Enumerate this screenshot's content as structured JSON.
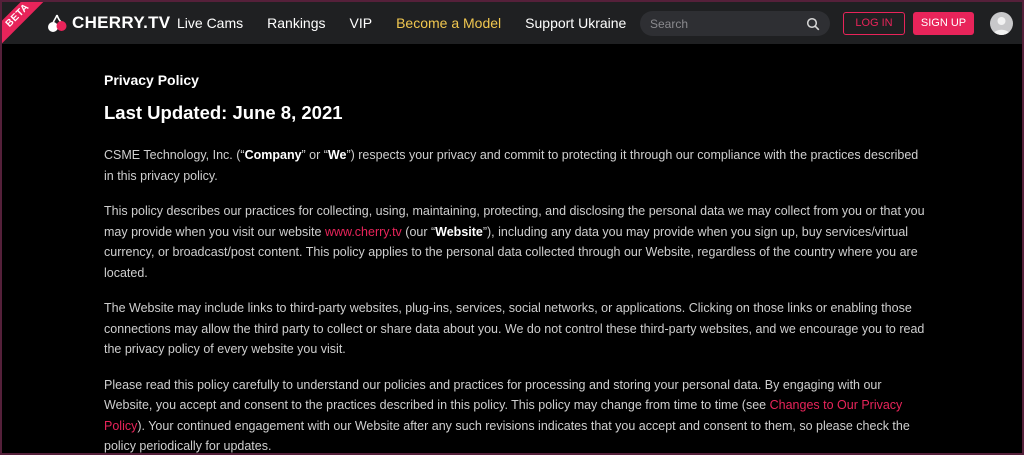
{
  "header": {
    "beta": "BETA",
    "logo_text": "CHERRY.TV",
    "nav": [
      "Live Cams",
      "Rankings",
      "VIP",
      "Become a Model",
      "Support Ukraine"
    ],
    "search_placeholder": "Search",
    "login_label": "LOG IN",
    "signup_label": "SIGN UP"
  },
  "policy": {
    "label": "Privacy Policy",
    "last_updated": "Last Updated: June 8, 2021",
    "p1": {
      "a": "CSME Technology, Inc. (“",
      "company": "Company",
      "b": "” or “",
      "we": "We",
      "c": "”) respects your privacy and commit to protecting it through our compliance with the practices described in this privacy policy."
    },
    "p2": {
      "a": "This policy describes our practices for collecting, using, maintaining, protecting, and disclosing the personal data we may collect from you or that you may provide when you visit our website ",
      "link": "www.cherry.tv",
      "b": " (our “",
      "website": "Website",
      "c": "”), including any data you may provide when you sign up, buy services/virtual currency, or broadcast/post content. This policy applies to the personal data collected through our Website, regardless of the country where you are located."
    },
    "p3": "The Website may include links to third-party websites, plug-ins, services, social networks, or applications. Clicking on those links or enabling those connections may allow the third party to collect or share data about you. We do not control these third-party websites, and we encourage you to read the privacy policy of every website you visit.",
    "p4": {
      "a": "Please read this policy carefully to understand our policies and practices for processing and storing your personal data. By engaging with our Website, you accept and consent to the practices described in this policy. This policy may change from time to time (see ",
      "link": "Changes to Our Privacy Policy",
      "b": "). Your continued engagement with our Website after any such revisions indicates that you accept and consent to them, so please check the policy periodically for updates."
    }
  },
  "colors": {
    "accent": "#e8245a",
    "nav_highlight": "#f1c74f",
    "header_bg": "#1f2022",
    "page_bg": "#000000"
  }
}
